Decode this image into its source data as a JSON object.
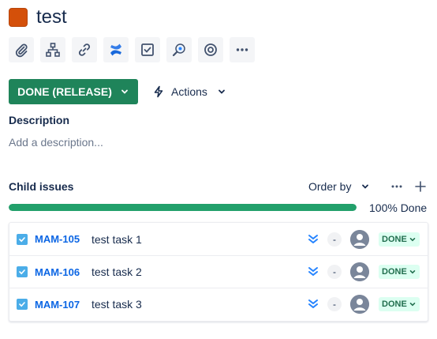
{
  "issue": {
    "title": "test",
    "type_color": "#d4500a"
  },
  "toolbar": {
    "icons": [
      "attachment-icon",
      "hierarchy-icon",
      "link-icon",
      "confluence-icon",
      "checklist-icon",
      "search-bug-icon",
      "target-icon",
      "more-icon"
    ]
  },
  "status": {
    "label": "DONE (RELEASE)",
    "color": "#1f845a"
  },
  "actions": {
    "label": "Actions"
  },
  "description": {
    "heading": "Description",
    "placeholder": "Add a description..."
  },
  "child_issues": {
    "heading": "Child issues",
    "order_by_label": "Order by",
    "progress_label": "100% Done",
    "progress_fraction": 1.0,
    "items": [
      {
        "key": "MAM-105",
        "summary": "test task 1",
        "estimate": "-",
        "status": "DONE"
      },
      {
        "key": "MAM-106",
        "summary": "test task 2",
        "estimate": "-",
        "status": "DONE"
      },
      {
        "key": "MAM-107",
        "summary": "test task 3",
        "estimate": "-",
        "status": "DONE"
      }
    ]
  },
  "colors": {
    "accent_blue": "#0c66e4",
    "done_green": "#22a06b",
    "priority_blue": "#2684ff"
  }
}
